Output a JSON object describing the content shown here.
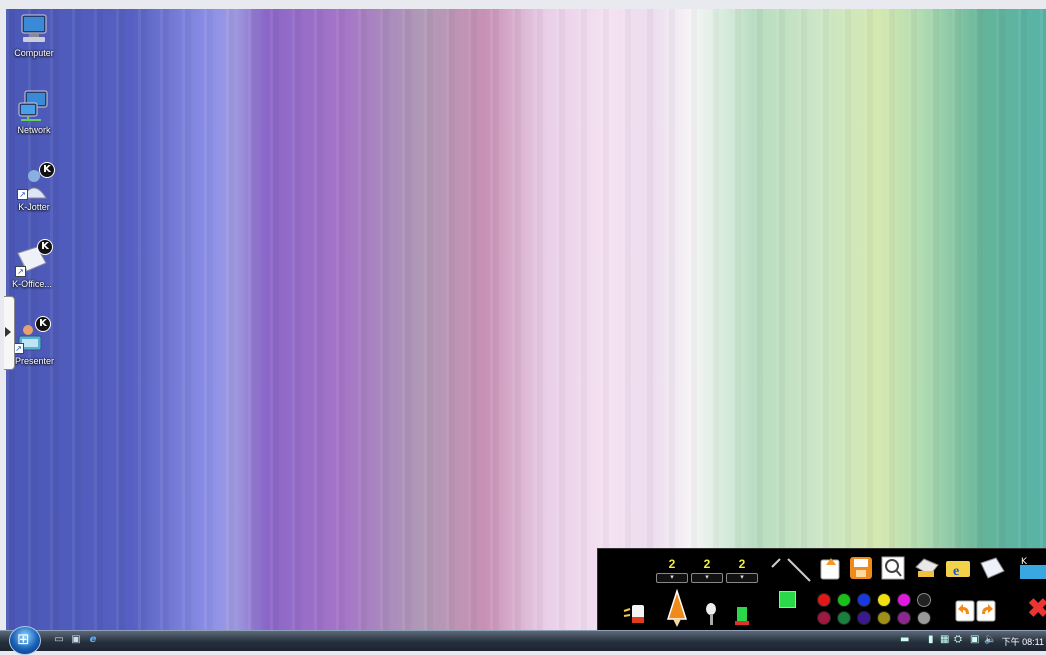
{
  "desktop": {
    "icons": [
      {
        "label": "Computer",
        "icon": "computer-icon"
      },
      {
        "label": "Network",
        "icon": "network-icon"
      },
      {
        "label": "K-Jotter",
        "icon": "k-jotter-icon"
      },
      {
        "label": "K-Office...",
        "icon": "k-office-icon"
      },
      {
        "label": "K-Presenter",
        "icon": "k-presenter-icon"
      }
    ],
    "badge_letter": "K"
  },
  "toolbar": {
    "counters": [
      {
        "value": "2"
      },
      {
        "value": "2"
      },
      {
        "value": "2"
      }
    ],
    "spin_symbol": "▾",
    "selected_color": "#2ad84a",
    "palette_row1": [
      "#e01818",
      "#18c018",
      "#1838e0",
      "#f0e010",
      "#e018e0",
      "#222222"
    ],
    "palette_row2": [
      "#a01840",
      "#18803a",
      "#3a1890",
      "#a09018",
      "#8a2890",
      "#9a9a9a"
    ],
    "close_symbol": "✖"
  },
  "taskbar": {
    "clock": "下午 08:11"
  }
}
